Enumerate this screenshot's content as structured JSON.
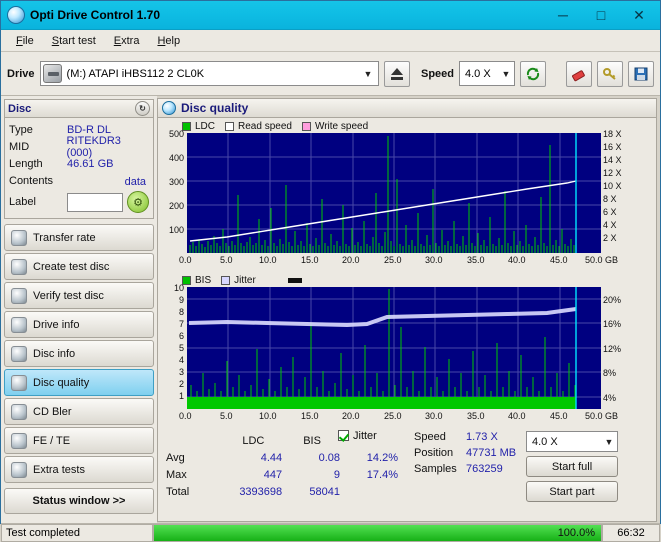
{
  "window": {
    "title": "Opti Drive Control 1.70",
    "minimize": "─",
    "maximize": "□",
    "close": "✕"
  },
  "menu": [
    {
      "label": "File"
    },
    {
      "label": "Start test"
    },
    {
      "label": "Extra"
    },
    {
      "label": "Help"
    }
  ],
  "toolbar": {
    "drive_label": "Drive",
    "drive_value": "(M:)  ATAPI iHBS112   2 CL0K",
    "eject_title": "eject",
    "speed_label": "Speed",
    "speed_value": "4.0 X",
    "refresh_icon": "refresh-icon",
    "eraser_icon": "eraser-icon",
    "key_icon": "key-icon",
    "save_icon": "save-icon"
  },
  "disc_panel": {
    "title": "Disc",
    "refresh_icon": "refresh-icon",
    "rows": [
      {
        "key": "Type",
        "value": "BD-R DL"
      },
      {
        "key": "MID",
        "value": "RITEKDR3 (000)"
      },
      {
        "key": "Length",
        "value": "46.61 GB"
      },
      {
        "key": "Contents",
        "value": "data"
      }
    ],
    "label_key": "Label",
    "label_value": ""
  },
  "nav": {
    "items": [
      {
        "label": "Transfer rate",
        "selected": false
      },
      {
        "label": "Create test disc",
        "selected": false
      },
      {
        "label": "Verify test disc",
        "selected": false
      },
      {
        "label": "Drive info",
        "selected": false
      },
      {
        "label": "Disc info",
        "selected": false
      },
      {
        "label": "Disc quality",
        "selected": true
      },
      {
        "label": "CD Bler",
        "selected": false
      },
      {
        "label": "FE / TE",
        "selected": false
      },
      {
        "label": "Extra tests",
        "selected": false
      }
    ],
    "status_window": "Status window >>"
  },
  "quality": {
    "title": "Disc quality",
    "legend_top": [
      {
        "label": "LDC",
        "color": "#00c000"
      },
      {
        "label": "Read speed",
        "color": "#ffffff"
      },
      {
        "label": "Write speed",
        "color": "#ff9edd"
      }
    ],
    "legend_bottom": [
      {
        "label": "BIS",
        "color": "#00c000"
      },
      {
        "label": "Jitter",
        "color": "#d8d8ff"
      }
    ],
    "top_chart": {
      "y_left_ticks": [
        "500",
        "400",
        "300",
        "200",
        "100"
      ],
      "y_right_ticks": [
        "18 X",
        "16 X",
        "14 X",
        "12 X",
        "10 X",
        "8 X",
        "6 X",
        "4 X",
        "2 X"
      ],
      "x_ticks": [
        "0.0",
        "5.0",
        "10.0",
        "15.0",
        "20.0",
        "25.0",
        "30.0",
        "35.0",
        "40.0",
        "45.0",
        "50.0 GB"
      ]
    },
    "bottom_chart": {
      "y_left_ticks": [
        "10",
        "9",
        "8",
        "7",
        "6",
        "5",
        "4",
        "3",
        "2",
        "1"
      ],
      "y_right_ticks": [
        "20%",
        "16%",
        "12%",
        "8%",
        "4%"
      ],
      "x_ticks": [
        "0.0",
        "5.0",
        "10.0",
        "15.0",
        "20.0",
        "25.0",
        "30.0",
        "35.0",
        "40.0",
        "45.0",
        "50.0 GB"
      ]
    },
    "stats": {
      "col_ldc": "LDC",
      "col_bis": "BIS",
      "jitter_label": "Jitter",
      "rows": [
        {
          "key": "Avg",
          "ldc": "4.44",
          "bis": "0.08",
          "jitter": "14.2%"
        },
        {
          "key": "Max",
          "ldc": "447",
          "bis": "9",
          "jitter": "17.4%"
        },
        {
          "key": "Total",
          "ldc": "3393698",
          "bis": "58041",
          "jitter": ""
        }
      ]
    },
    "right_stats": [
      {
        "key": "Speed",
        "value": "1.73 X"
      },
      {
        "key": "Position",
        "value": "47731 MB"
      },
      {
        "key": "Samples",
        "value": "763259"
      }
    ],
    "speed_select": "4.0 X",
    "start_full": "Start full",
    "start_part": "Start part"
  },
  "statusbar": {
    "message": "Test completed",
    "progress_text": "100.0%",
    "progress_pct": 100,
    "elapsed": "66:32"
  },
  "colors": {
    "plot_bg": "#000080",
    "grid": "#4a4aa8",
    "ldc_green": "#00c000",
    "read_speed": "#ffffff",
    "jitter": "#d9d9f5",
    "accent": "#12bfe6"
  }
}
